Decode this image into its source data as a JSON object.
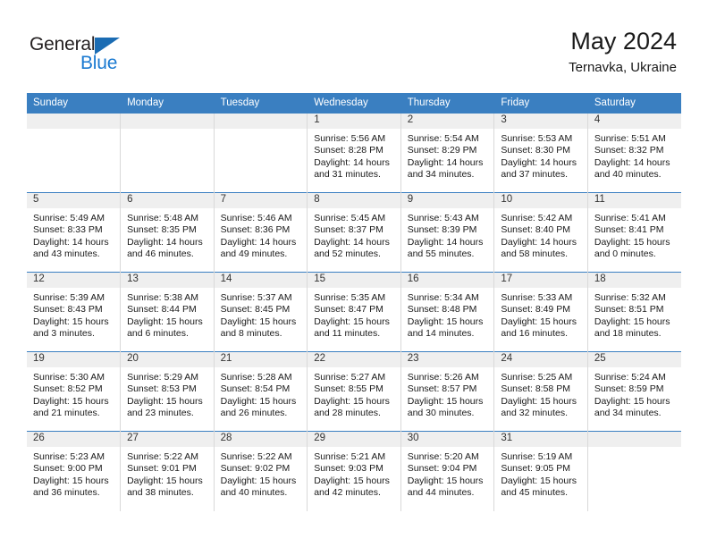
{
  "brand": {
    "name_part1": "General",
    "name_part2": "Blue",
    "triangle_icon": "triangle-icon",
    "accent_blue": "#1b7ad1",
    "dark": "#231f20"
  },
  "header": {
    "title": "May 2024",
    "subtitle": "Ternavka, Ukraine"
  },
  "theme": {
    "header_row_bg": "#3a7fc1",
    "daynum_band_bg": "#efefef",
    "week_separator": "#3a7fc1",
    "cell_border": "#d9d9d9"
  },
  "calendar": {
    "day_headers": [
      "Sunday",
      "Monday",
      "Tuesday",
      "Wednesday",
      "Thursday",
      "Friday",
      "Saturday"
    ],
    "labels": {
      "sunrise": "Sunrise:",
      "sunset": "Sunset:",
      "daylight": "Daylight:"
    },
    "weeks": [
      [
        {
          "day": "",
          "sunrise": "",
          "sunset": "",
          "daylight_line1": "",
          "daylight_line2": ""
        },
        {
          "day": "",
          "sunrise": "",
          "sunset": "",
          "daylight_line1": "",
          "daylight_line2": ""
        },
        {
          "day": "",
          "sunrise": "",
          "sunset": "",
          "daylight_line1": "",
          "daylight_line2": ""
        },
        {
          "day": "1",
          "sunrise": "Sunrise: 5:56 AM",
          "sunset": "Sunset: 8:28 PM",
          "daylight_line1": "Daylight: 14 hours",
          "daylight_line2": "and 31 minutes."
        },
        {
          "day": "2",
          "sunrise": "Sunrise: 5:54 AM",
          "sunset": "Sunset: 8:29 PM",
          "daylight_line1": "Daylight: 14 hours",
          "daylight_line2": "and 34 minutes."
        },
        {
          "day": "3",
          "sunrise": "Sunrise: 5:53 AM",
          "sunset": "Sunset: 8:30 PM",
          "daylight_line1": "Daylight: 14 hours",
          "daylight_line2": "and 37 minutes."
        },
        {
          "day": "4",
          "sunrise": "Sunrise: 5:51 AM",
          "sunset": "Sunset: 8:32 PM",
          "daylight_line1": "Daylight: 14 hours",
          "daylight_line2": "and 40 minutes."
        }
      ],
      [
        {
          "day": "5",
          "sunrise": "Sunrise: 5:49 AM",
          "sunset": "Sunset: 8:33 PM",
          "daylight_line1": "Daylight: 14 hours",
          "daylight_line2": "and 43 minutes."
        },
        {
          "day": "6",
          "sunrise": "Sunrise: 5:48 AM",
          "sunset": "Sunset: 8:35 PM",
          "daylight_line1": "Daylight: 14 hours",
          "daylight_line2": "and 46 minutes."
        },
        {
          "day": "7",
          "sunrise": "Sunrise: 5:46 AM",
          "sunset": "Sunset: 8:36 PM",
          "daylight_line1": "Daylight: 14 hours",
          "daylight_line2": "and 49 minutes."
        },
        {
          "day": "8",
          "sunrise": "Sunrise: 5:45 AM",
          "sunset": "Sunset: 8:37 PM",
          "daylight_line1": "Daylight: 14 hours",
          "daylight_line2": "and 52 minutes."
        },
        {
          "day": "9",
          "sunrise": "Sunrise: 5:43 AM",
          "sunset": "Sunset: 8:39 PM",
          "daylight_line1": "Daylight: 14 hours",
          "daylight_line2": "and 55 minutes."
        },
        {
          "day": "10",
          "sunrise": "Sunrise: 5:42 AM",
          "sunset": "Sunset: 8:40 PM",
          "daylight_line1": "Daylight: 14 hours",
          "daylight_line2": "and 58 minutes."
        },
        {
          "day": "11",
          "sunrise": "Sunrise: 5:41 AM",
          "sunset": "Sunset: 8:41 PM",
          "daylight_line1": "Daylight: 15 hours",
          "daylight_line2": "and 0 minutes."
        }
      ],
      [
        {
          "day": "12",
          "sunrise": "Sunrise: 5:39 AM",
          "sunset": "Sunset: 8:43 PM",
          "daylight_line1": "Daylight: 15 hours",
          "daylight_line2": "and 3 minutes."
        },
        {
          "day": "13",
          "sunrise": "Sunrise: 5:38 AM",
          "sunset": "Sunset: 8:44 PM",
          "daylight_line1": "Daylight: 15 hours",
          "daylight_line2": "and 6 minutes."
        },
        {
          "day": "14",
          "sunrise": "Sunrise: 5:37 AM",
          "sunset": "Sunset: 8:45 PM",
          "daylight_line1": "Daylight: 15 hours",
          "daylight_line2": "and 8 minutes."
        },
        {
          "day": "15",
          "sunrise": "Sunrise: 5:35 AM",
          "sunset": "Sunset: 8:47 PM",
          "daylight_line1": "Daylight: 15 hours",
          "daylight_line2": "and 11 minutes."
        },
        {
          "day": "16",
          "sunrise": "Sunrise: 5:34 AM",
          "sunset": "Sunset: 8:48 PM",
          "daylight_line1": "Daylight: 15 hours",
          "daylight_line2": "and 14 minutes."
        },
        {
          "day": "17",
          "sunrise": "Sunrise: 5:33 AM",
          "sunset": "Sunset: 8:49 PM",
          "daylight_line1": "Daylight: 15 hours",
          "daylight_line2": "and 16 minutes."
        },
        {
          "day": "18",
          "sunrise": "Sunrise: 5:32 AM",
          "sunset": "Sunset: 8:51 PM",
          "daylight_line1": "Daylight: 15 hours",
          "daylight_line2": "and 18 minutes."
        }
      ],
      [
        {
          "day": "19",
          "sunrise": "Sunrise: 5:30 AM",
          "sunset": "Sunset: 8:52 PM",
          "daylight_line1": "Daylight: 15 hours",
          "daylight_line2": "and 21 minutes."
        },
        {
          "day": "20",
          "sunrise": "Sunrise: 5:29 AM",
          "sunset": "Sunset: 8:53 PM",
          "daylight_line1": "Daylight: 15 hours",
          "daylight_line2": "and 23 minutes."
        },
        {
          "day": "21",
          "sunrise": "Sunrise: 5:28 AM",
          "sunset": "Sunset: 8:54 PM",
          "daylight_line1": "Daylight: 15 hours",
          "daylight_line2": "and 26 minutes."
        },
        {
          "day": "22",
          "sunrise": "Sunrise: 5:27 AM",
          "sunset": "Sunset: 8:55 PM",
          "daylight_line1": "Daylight: 15 hours",
          "daylight_line2": "and 28 minutes."
        },
        {
          "day": "23",
          "sunrise": "Sunrise: 5:26 AM",
          "sunset": "Sunset: 8:57 PM",
          "daylight_line1": "Daylight: 15 hours",
          "daylight_line2": "and 30 minutes."
        },
        {
          "day": "24",
          "sunrise": "Sunrise: 5:25 AM",
          "sunset": "Sunset: 8:58 PM",
          "daylight_line1": "Daylight: 15 hours",
          "daylight_line2": "and 32 minutes."
        },
        {
          "day": "25",
          "sunrise": "Sunrise: 5:24 AM",
          "sunset": "Sunset: 8:59 PM",
          "daylight_line1": "Daylight: 15 hours",
          "daylight_line2": "and 34 minutes."
        }
      ],
      [
        {
          "day": "26",
          "sunrise": "Sunrise: 5:23 AM",
          "sunset": "Sunset: 9:00 PM",
          "daylight_line1": "Daylight: 15 hours",
          "daylight_line2": "and 36 minutes."
        },
        {
          "day": "27",
          "sunrise": "Sunrise: 5:22 AM",
          "sunset": "Sunset: 9:01 PM",
          "daylight_line1": "Daylight: 15 hours",
          "daylight_line2": "and 38 minutes."
        },
        {
          "day": "28",
          "sunrise": "Sunrise: 5:22 AM",
          "sunset": "Sunset: 9:02 PM",
          "daylight_line1": "Daylight: 15 hours",
          "daylight_line2": "and 40 minutes."
        },
        {
          "day": "29",
          "sunrise": "Sunrise: 5:21 AM",
          "sunset": "Sunset: 9:03 PM",
          "daylight_line1": "Daylight: 15 hours",
          "daylight_line2": "and 42 minutes."
        },
        {
          "day": "30",
          "sunrise": "Sunrise: 5:20 AM",
          "sunset": "Sunset: 9:04 PM",
          "daylight_line1": "Daylight: 15 hours",
          "daylight_line2": "and 44 minutes."
        },
        {
          "day": "31",
          "sunrise": "Sunrise: 5:19 AM",
          "sunset": "Sunset: 9:05 PM",
          "daylight_line1": "Daylight: 15 hours",
          "daylight_line2": "and 45 minutes."
        },
        {
          "day": "",
          "sunrise": "",
          "sunset": "",
          "daylight_line1": "",
          "daylight_line2": ""
        }
      ]
    ]
  }
}
